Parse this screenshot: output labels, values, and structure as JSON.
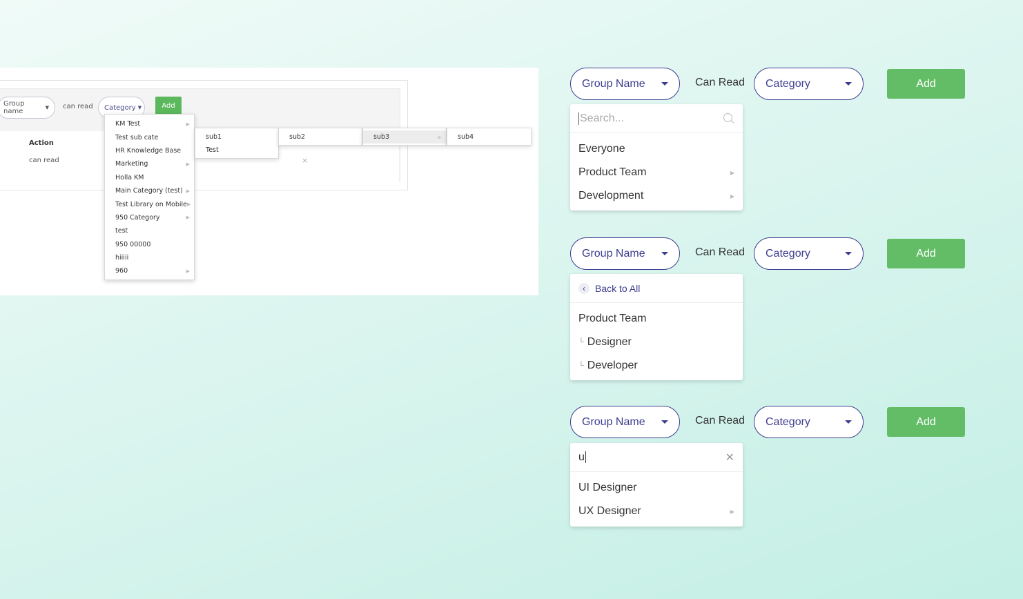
{
  "legacy": {
    "group_pill": "Group name",
    "can_read": "can read",
    "category_pill": "Category",
    "add": "Add",
    "table_header": "Action",
    "table_value": "can read",
    "category_menu": [
      {
        "label": "KM Test",
        "has_sub": true
      },
      {
        "label": "Test sub cate",
        "has_sub": false
      },
      {
        "label": "HR Knowledge Base",
        "has_sub": false
      },
      {
        "label": "Marketing",
        "has_sub": true
      },
      {
        "label": "Holla KM",
        "has_sub": false
      },
      {
        "label": "Main Category (test)",
        "has_sub": true
      },
      {
        "label": "Test Library on Mobile",
        "has_sub": true
      },
      {
        "label": "950 Category",
        "has_sub": true
      },
      {
        "label": "test",
        "has_sub": false
      },
      {
        "label": "950 00000",
        "has_sub": false
      },
      {
        "label": "hiiiii",
        "has_sub": false
      },
      {
        "label": "960",
        "has_sub": true
      }
    ],
    "sub1": [
      "sub1",
      "Test"
    ],
    "sub2": [
      "sub2"
    ],
    "sub3": [
      "sub3"
    ],
    "sub4": [
      "sub4"
    ]
  },
  "rows": [
    {
      "group": "Group Name",
      "can_read": "Can Read",
      "category": "Category",
      "add": "Add"
    },
    {
      "group": "Group Name",
      "can_read": "Can Read",
      "category": "Category",
      "add": "Add"
    },
    {
      "group": "Group Name",
      "can_read": "Can Read",
      "category": "Category",
      "add": "Add"
    }
  ],
  "panel1": {
    "search_placeholder": "Search...",
    "items": [
      {
        "label": "Everyone",
        "has_sub": false
      },
      {
        "label": "Product Team",
        "has_sub": true
      },
      {
        "label": "Development",
        "has_sub": true
      }
    ]
  },
  "panel2": {
    "back_label": "Back to All",
    "parent": "Product Team",
    "children": [
      "Designer",
      "Developer"
    ]
  },
  "panel3": {
    "query": "u",
    "items": [
      {
        "label": "UI Designer",
        "has_sub": false
      },
      {
        "label": "UX Designer",
        "has_sub": true
      }
    ]
  },
  "colors": {
    "accent": "#3d3d8f",
    "add_green": "#63bd67",
    "legacy_green": "#5cb85c"
  }
}
